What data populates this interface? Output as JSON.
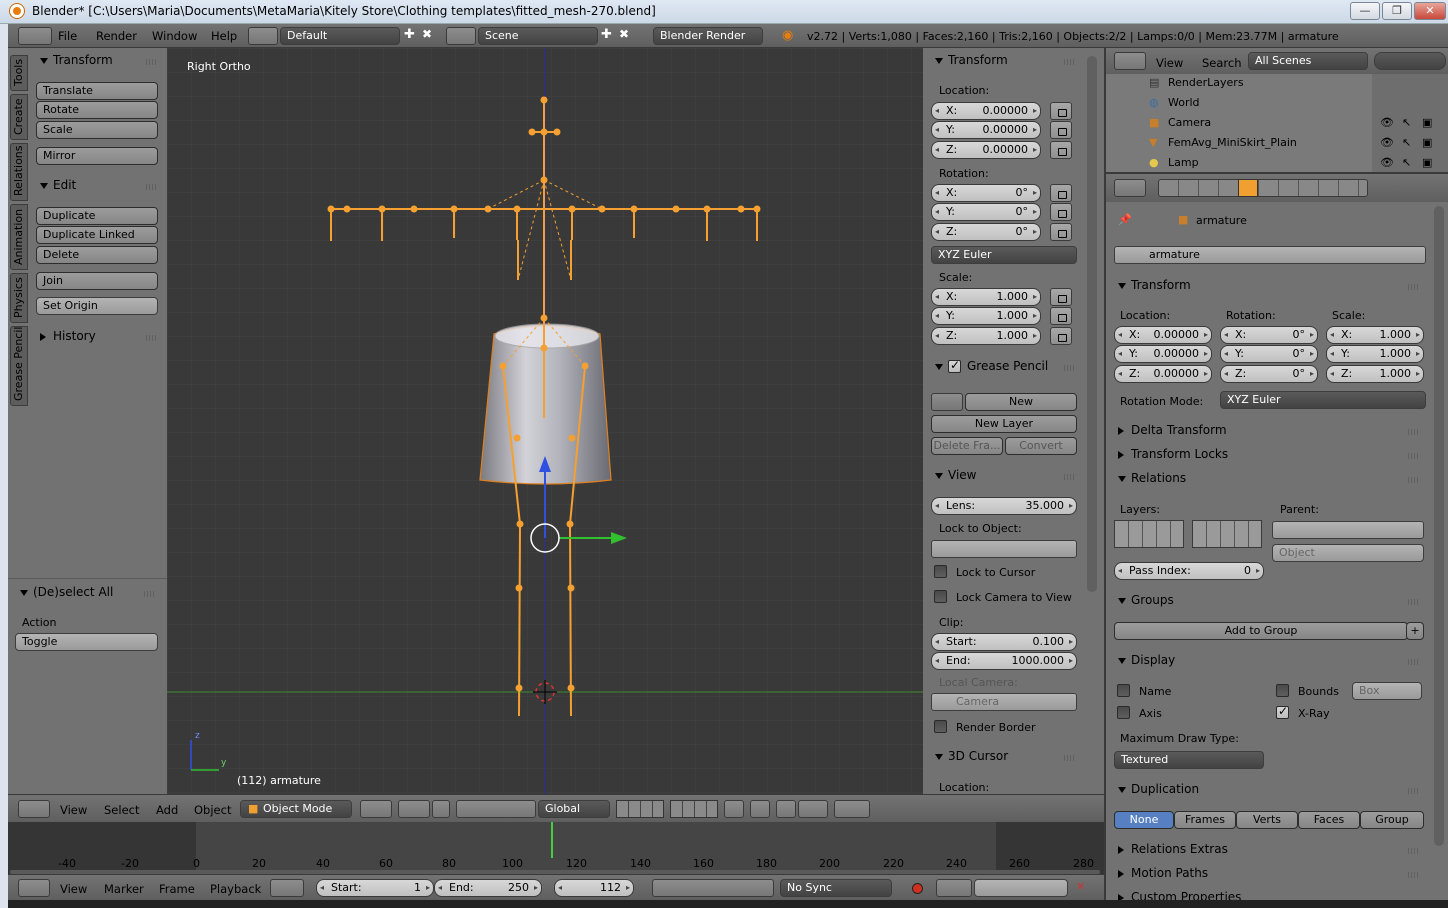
{
  "window": {
    "title": "Blender* [C:\\Users\\Maria\\Documents\\MetaMaria\\Kitely Store\\Clothing templates\\fitted_mesh-270.blend]",
    "min": "—",
    "max": "❐",
    "close": "✕"
  },
  "info_header": {
    "menus": [
      "File",
      "Render",
      "Window",
      "Help"
    ],
    "layout": "Default",
    "scene": "Scene",
    "engine": "Blender Render",
    "stats": "v2.72 | Verts:1,080 | Faces:2,160 | Tris:2,160 | Objects:2/2 | Lamps:0/0 | Mem:23.77M | armature"
  },
  "tool_tabs": [
    "Tools",
    "Create",
    "Relations",
    "Animation",
    "Physics",
    "Grease Pencil"
  ],
  "toolshelf": {
    "transform": {
      "title": "Transform",
      "buttons": [
        "Translate",
        "Rotate",
        "Scale",
        "Mirror"
      ]
    },
    "edit": {
      "title": "Edit",
      "buttons": [
        "Duplicate",
        "Duplicate Linked",
        "Delete",
        "Join"
      ],
      "set_origin": "Set Origin"
    },
    "history": {
      "title": "History"
    },
    "operator": {
      "title": "(De)select All",
      "action_label": "Action",
      "action_value": "Toggle"
    }
  },
  "viewport": {
    "view_name": "Right Ortho",
    "object_info": "(112) armature",
    "axis_z": "z",
    "axis_y": "y"
  },
  "properties_n": {
    "transform": {
      "title": "Transform",
      "location_label": "Location:",
      "location": [
        {
          "k": "X:",
          "v": "0.00000"
        },
        {
          "k": "Y:",
          "v": "0.00000"
        },
        {
          "k": "Z:",
          "v": "0.00000"
        }
      ],
      "rotation_label": "Rotation:",
      "rotation": [
        {
          "k": "X:",
          "v": "0°"
        },
        {
          "k": "Y:",
          "v": "0°"
        },
        {
          "k": "Z:",
          "v": "0°"
        }
      ],
      "rotation_mode": "XYZ Euler",
      "scale_label": "Scale:",
      "scale": [
        {
          "k": "X:",
          "v": "1.000"
        },
        {
          "k": "Y:",
          "v": "1.000"
        },
        {
          "k": "Z:",
          "v": "1.000"
        }
      ]
    },
    "grease_pencil": {
      "title": "Grease Pencil",
      "new": "New",
      "new_layer": "New Layer",
      "delete_frame": "Delete Fra...",
      "convert": "Convert"
    },
    "view": {
      "title": "View",
      "lens_label": "Lens:",
      "lens": "35.000",
      "lock_to_object": "Lock to Object:",
      "lock_to_cursor": "Lock to Cursor",
      "lock_camera": "Lock Camera to View",
      "clip": "Clip:",
      "clip_start_label": "Start:",
      "clip_start": "0.100",
      "clip_end_label": "End:",
      "clip_end": "1000.000",
      "local_camera": "Local Camera:",
      "camera": "Camera",
      "render_border": "Render Border"
    },
    "cursor": {
      "title": "3D Cursor",
      "location": "Location:"
    }
  },
  "outliner": {
    "menus": [
      "View",
      "Search"
    ],
    "scenes": "All Scenes",
    "items": [
      "RenderLayers",
      "World",
      "Camera",
      "FemAvg_MiniSkirt_Plain",
      "Lamp"
    ]
  },
  "object_props": {
    "breadcrumb": "armature",
    "name": "armature",
    "transform": {
      "title": "Transform",
      "location_label": "Location:",
      "rotation_label": "Rotation:",
      "scale_label": "Scale:",
      "location": [
        {
          "k": "X:",
          "v": "0.00000"
        },
        {
          "k": "Y:",
          "v": "0.00000"
        },
        {
          "k": "Z:",
          "v": "0.00000"
        }
      ],
      "rotation": [
        {
          "k": "X:",
          "v": "0°"
        },
        {
          "k": "Y:",
          "v": "0°"
        },
        {
          "k": "Z:",
          "v": "0°"
        }
      ],
      "scale": [
        {
          "k": "X:",
          "v": "1.000"
        },
        {
          "k": "Y:",
          "v": "1.000"
        },
        {
          "k": "Z:",
          "v": "1.000"
        }
      ],
      "rotation_mode_label": "Rotation Mode:",
      "rotation_mode": "XYZ Euler"
    },
    "delta_transform": "Delta Transform",
    "transform_locks": "Transform Locks",
    "relations": {
      "title": "Relations",
      "layers": "Layers:",
      "parent": "Parent:",
      "parent_type": "Object",
      "pass_index_label": "Pass Index:",
      "pass_index": "0"
    },
    "groups": {
      "title": "Groups",
      "add": "Add to Group"
    },
    "display": {
      "title": "Display",
      "name": "Name",
      "bounds": "Bounds",
      "bounds_type": "Box",
      "axis": "Axis",
      "xray": "X-Ray",
      "max_draw_label": "Maximum Draw Type:",
      "max_draw": "Textured"
    },
    "duplication": {
      "title": "Duplication",
      "options": [
        "None",
        "Frames",
        "Verts",
        "Faces",
        "Group"
      ]
    },
    "relations_extras": "Relations Extras",
    "motion_paths": "Motion Paths",
    "custom_props": "Custom Properties"
  },
  "view3d_header": {
    "menus": [
      "View",
      "Select",
      "Add",
      "Object"
    ],
    "mode": "Object Mode",
    "orientation": "Global"
  },
  "timeline": {
    "ticks": [
      "-40",
      "-20",
      "0",
      "20",
      "40",
      "60",
      "80",
      "100",
      "120",
      "140",
      "160",
      "180",
      "200",
      "220",
      "240",
      "260",
      "280"
    ],
    "menus": [
      "View",
      "Marker",
      "Frame",
      "Playback"
    ],
    "start_label": "Start:",
    "start": "1",
    "end_label": "End:",
    "end": "250",
    "current": "112",
    "sync": "No Sync"
  },
  "colors": {
    "bone": "#f5a030",
    "viewport_bg": "#393939",
    "panel_bg": "#727272",
    "accent_blue": "#5680c2"
  }
}
